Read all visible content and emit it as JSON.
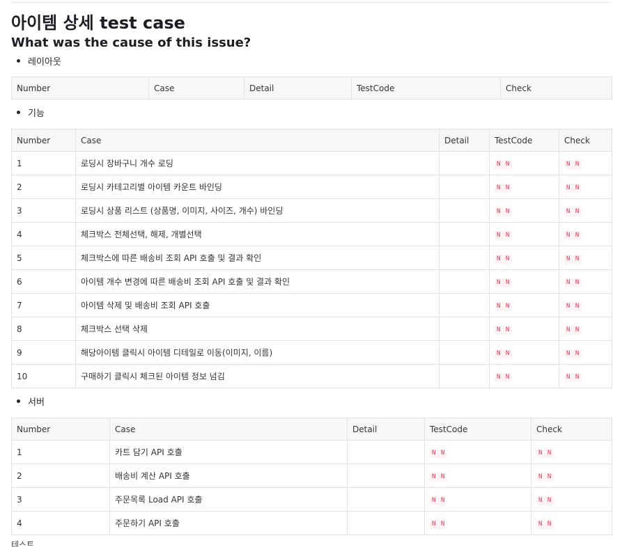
{
  "page": {
    "title": "아이템 상세 test case",
    "subtitle": "What was the cause of this issue?"
  },
  "sections": {
    "layout": {
      "label": "레이아웃",
      "headers": [
        "Number",
        "Case",
        "Detail",
        "TestCode",
        "Check"
      ]
    },
    "feature": {
      "label": "기능",
      "headers": [
        "Number",
        "Case",
        "Detail",
        "TestCode",
        "Check"
      ],
      "rows": [
        {
          "number": "1",
          "case": "로딩시 장바구니 개수 로딩",
          "detail": "",
          "testcode": "N N",
          "check": "N N"
        },
        {
          "number": "2",
          "case": "로딩시 카테고리별 아이템 카운트 바인딩",
          "detail": "",
          "testcode": "N N",
          "check": "N N"
        },
        {
          "number": "3",
          "case": "로딩시 상품 리스트 (상품명, 이미지, 사이즈, 개수) 바인딩",
          "detail": "",
          "testcode": "N N",
          "check": "N N"
        },
        {
          "number": "4",
          "case": "체크박스 전체선택, 해제, 개별선택",
          "detail": "",
          "testcode": "N N",
          "check": "N N"
        },
        {
          "number": "5",
          "case": "체크박스에 따른 배송비 조회 API 호출 및 결과 확인",
          "detail": "",
          "testcode": "N N",
          "check": "N N"
        },
        {
          "number": "6",
          "case": "아이템 개수 변경에 따른 배송비 조회 API 호출 및 결과 확인",
          "detail": "",
          "testcode": "N N",
          "check": "N N"
        },
        {
          "number": "7",
          "case": "아이템 삭제 및 배송비 조회 API 호출",
          "detail": "",
          "testcode": "N N",
          "check": "N N"
        },
        {
          "number": "8",
          "case": "체크박스 선택 삭제",
          "detail": "",
          "testcode": "N N",
          "check": "N N"
        },
        {
          "number": "9",
          "case": "해당아이템 클릭시 아이템 디테일로 이동(이미지, 이름)",
          "detail": "",
          "testcode": "N N",
          "check": "N N"
        },
        {
          "number": "10",
          "case": "구매하기 클릭시 체크된 아이템 정보 넘김",
          "detail": "",
          "testcode": "N N",
          "check": "N N"
        }
      ]
    },
    "server": {
      "label": "서버",
      "headers": [
        "Number",
        "Case",
        "Detail",
        "TestCode",
        "Check"
      ],
      "rows": [
        {
          "number": "1",
          "case": "카트 담기 API 호출",
          "detail": "",
          "testcode": "N N",
          "check": "N N"
        },
        {
          "number": "2",
          "case": "배송비 계산 API 호출",
          "detail": "",
          "testcode": "N N",
          "check": "N N"
        },
        {
          "number": "3",
          "case": "주문목록 Load API 호출",
          "detail": "",
          "testcode": "N N",
          "check": "N N"
        },
        {
          "number": "4",
          "case": "주문하기 API 호출",
          "detail": "",
          "testcode": "N N",
          "check": "N N"
        }
      ]
    }
  },
  "footer_cut_text": "테스트"
}
